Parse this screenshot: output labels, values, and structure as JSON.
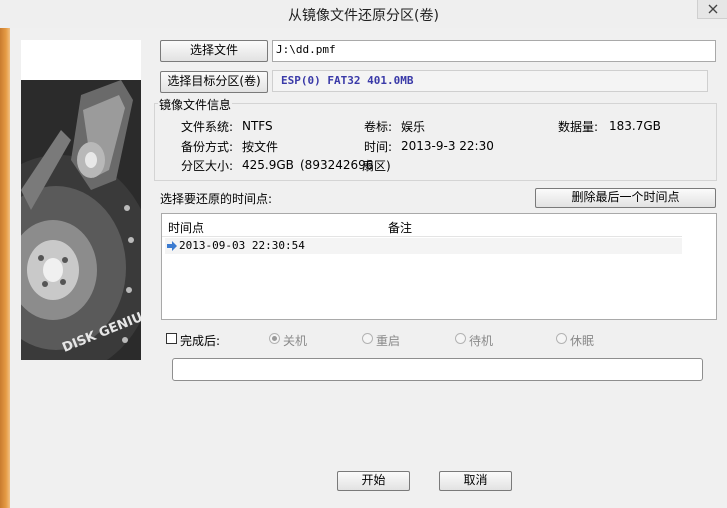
{
  "window": {
    "title": "从镜像文件还原分区(卷)"
  },
  "image_file": {
    "button_label": "选择文件",
    "path": "J:\\dd.pmf"
  },
  "target": {
    "button_label": "选择目标分区(卷)",
    "value": "ESP(0) FAT32 401.0MB"
  },
  "info": {
    "group_label": "镜像文件信息",
    "fs_label": "文件系统:",
    "fs_value": "NTFS",
    "vol_label": "卷标:",
    "vol_value": "娱乐",
    "size_label": "数据量:",
    "size_value": "183.7GB",
    "mode_label": "备份方式:",
    "mode_value": "按文件",
    "time_label": "时间:",
    "time_value": "2013-9-3 22:30",
    "part_label": "分区大小:",
    "part_value": "425.9GB",
    "part_extra_num": "(893242696",
    "part_extra_unit": "扇区)"
  },
  "restore_points": {
    "label": "选择要还原的时间点:",
    "delete_button": "删除最后一个时间点",
    "columns": [
      "时间点",
      "备注"
    ],
    "rows": [
      {
        "time": "2013-09-03 22:30:54",
        "note": ""
      }
    ]
  },
  "after": {
    "checkbox_label": "完成后:",
    "checked": false,
    "options": [
      {
        "label": "关机",
        "selected": true
      },
      {
        "label": "重启",
        "selected": false
      },
      {
        "label": "待机",
        "selected": false
      },
      {
        "label": "休眠",
        "selected": false
      }
    ]
  },
  "progress": {
    "fraction": 0
  },
  "buttons": {
    "start": "开始",
    "cancel": "取消"
  },
  "branding": {
    "logo_text": "DISK GENIUS"
  },
  "colors": {
    "target_text": "#3a3aa8",
    "sidebar_orange": "#e59b45"
  }
}
